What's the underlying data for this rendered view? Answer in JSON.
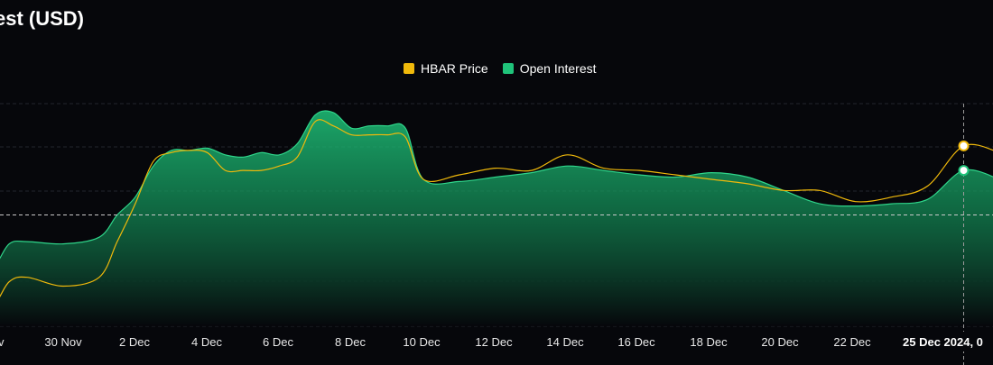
{
  "header": {
    "title": "est (USD)"
  },
  "legend": [
    {
      "label": "HBAR Price",
      "color": "#f0b90b"
    },
    {
      "label": "Open Interest",
      "color": "#1fc37a"
    }
  ],
  "hover": {
    "date_label": "25 Dec 2024, 0"
  },
  "chart_data": {
    "type": "area",
    "title": "est (USD)",
    "x_ticks": [
      "Nov",
      "30 Nov",
      "2 Dec",
      "4 Dec",
      "6 Dec",
      "8 Dec",
      "10 Dec",
      "12 Dec",
      "14 Dec",
      "16 Dec",
      "18 Dec",
      "20 Dec",
      "22 Dec"
    ],
    "x_range": [
      "2024-11-27",
      "2024-12-26"
    ],
    "y_axis": {
      "tick_labels_visible": false,
      "grid": true
    },
    "normalized_values": true,
    "series": [
      {
        "name": "Open Interest",
        "kind": "area",
        "color": "#1fc37a",
        "points": [
          [
            "2024-11-27",
            0.22
          ],
          [
            "2024-11-28",
            0.26
          ],
          [
            "2024-11-28 12:00",
            0.37
          ],
          [
            "2024-11-29",
            0.38
          ],
          [
            "2024-11-30",
            0.37
          ],
          [
            "2024-12-01",
            0.4
          ],
          [
            "2024-12-01 12:00",
            0.5
          ],
          [
            "2024-12-02",
            0.58
          ],
          [
            "2024-12-02 12:00",
            0.72
          ],
          [
            "2024-12-03",
            0.79
          ],
          [
            "2024-12-03 12:00",
            0.79
          ],
          [
            "2024-12-04",
            0.8
          ],
          [
            "2024-12-04 12:00",
            0.77
          ],
          [
            "2024-12-05",
            0.76
          ],
          [
            "2024-12-05 12:00",
            0.78
          ],
          [
            "2024-12-06",
            0.77
          ],
          [
            "2024-12-06 12:00",
            0.82
          ],
          [
            "2024-12-07",
            0.95
          ],
          [
            "2024-12-07 12:00",
            0.96
          ],
          [
            "2024-12-08",
            0.89
          ],
          [
            "2024-12-08 12:00",
            0.9
          ],
          [
            "2024-12-09",
            0.9
          ],
          [
            "2024-12-09 12:00",
            0.89
          ],
          [
            "2024-12-10",
            0.66
          ],
          [
            "2024-12-11",
            0.65
          ],
          [
            "2024-12-12",
            0.67
          ],
          [
            "2024-12-13",
            0.69
          ],
          [
            "2024-12-14",
            0.72
          ],
          [
            "2024-12-15",
            0.7
          ],
          [
            "2024-12-16",
            0.68
          ],
          [
            "2024-12-17",
            0.67
          ],
          [
            "2024-12-18",
            0.69
          ],
          [
            "2024-12-19",
            0.67
          ],
          [
            "2024-12-20",
            0.61
          ],
          [
            "2024-12-21",
            0.55
          ],
          [
            "2024-12-22",
            0.54
          ],
          [
            "2024-12-23",
            0.55
          ],
          [
            "2024-12-24",
            0.57
          ],
          [
            "2024-12-25",
            0.7
          ],
          [
            "2024-12-26",
            0.66
          ]
        ]
      },
      {
        "name": "HBAR Price",
        "kind": "line",
        "color": "#f0b90b",
        "points": [
          [
            "2024-11-27",
            0.07
          ],
          [
            "2024-11-28",
            0.09
          ],
          [
            "2024-11-28 12:00",
            0.2
          ],
          [
            "2024-11-29",
            0.22
          ],
          [
            "2024-11-30",
            0.18
          ],
          [
            "2024-12-01",
            0.22
          ],
          [
            "2024-12-01 12:00",
            0.38
          ],
          [
            "2024-12-02",
            0.55
          ],
          [
            "2024-12-02 12:00",
            0.74
          ],
          [
            "2024-12-03",
            0.78
          ],
          [
            "2024-12-03 12:00",
            0.79
          ],
          [
            "2024-12-04",
            0.78
          ],
          [
            "2024-12-04 12:00",
            0.7
          ],
          [
            "2024-12-05",
            0.7
          ],
          [
            "2024-12-05 12:00",
            0.7
          ],
          [
            "2024-12-06",
            0.72
          ],
          [
            "2024-12-06 12:00",
            0.76
          ],
          [
            "2024-12-07",
            0.92
          ],
          [
            "2024-12-07 12:00",
            0.9
          ],
          [
            "2024-12-08",
            0.86
          ],
          [
            "2024-12-08 12:00",
            0.86
          ],
          [
            "2024-12-09",
            0.86
          ],
          [
            "2024-12-09 12:00",
            0.85
          ],
          [
            "2024-12-10",
            0.66
          ],
          [
            "2024-12-11",
            0.68
          ],
          [
            "2024-12-12",
            0.71
          ],
          [
            "2024-12-13",
            0.7
          ],
          [
            "2024-12-14",
            0.77
          ],
          [
            "2024-12-15",
            0.71
          ],
          [
            "2024-12-16",
            0.7
          ],
          [
            "2024-12-17",
            0.68
          ],
          [
            "2024-12-18",
            0.66
          ],
          [
            "2024-12-19",
            0.64
          ],
          [
            "2024-12-20",
            0.61
          ],
          [
            "2024-12-21",
            0.61
          ],
          [
            "2024-12-22",
            0.56
          ],
          [
            "2024-12-23",
            0.58
          ],
          [
            "2024-12-24",
            0.63
          ],
          [
            "2024-12-25",
            0.81
          ],
          [
            "2024-12-26",
            0.78
          ]
        ]
      }
    ],
    "hover_point": {
      "x": "2024-12-25",
      "price": 0.81,
      "open_interest": 0.7
    },
    "reference_line": {
      "value": 0.5,
      "style": "dashed"
    }
  }
}
